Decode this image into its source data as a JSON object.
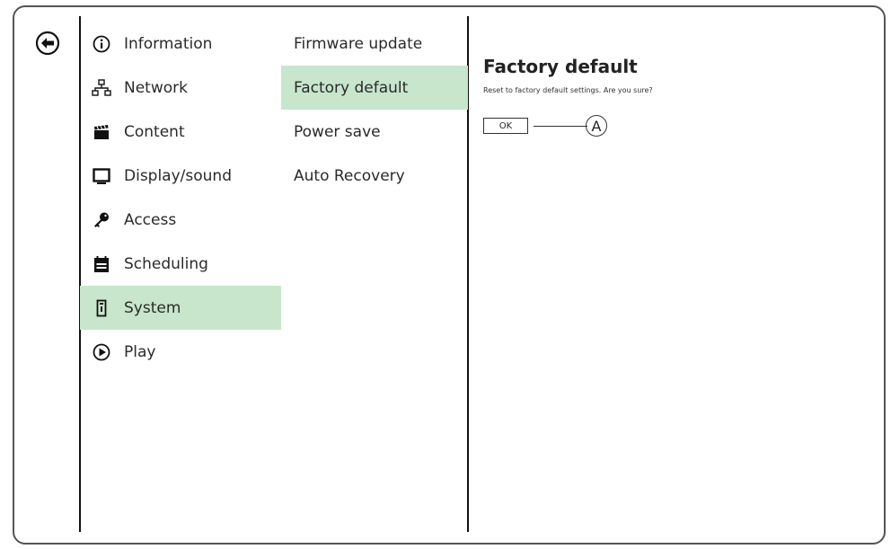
{
  "main_nav": [
    {
      "label": "Information",
      "icon": "info-icon"
    },
    {
      "label": "Network",
      "icon": "network-icon"
    },
    {
      "label": "Content",
      "icon": "clapperboard-icon"
    },
    {
      "label": "Display/sound",
      "icon": "monitor-icon"
    },
    {
      "label": "Access",
      "icon": "key-icon"
    },
    {
      "label": "Scheduling",
      "icon": "calendar-icon"
    },
    {
      "label": "System",
      "icon": "system-icon",
      "selected": true
    },
    {
      "label": "Play",
      "icon": "play-icon"
    }
  ],
  "sub_nav": [
    {
      "label": "Firmware update"
    },
    {
      "label": "Factory default",
      "selected": true
    },
    {
      "label": "Power save"
    },
    {
      "label": "Auto Recovery"
    }
  ],
  "content": {
    "title": "Factory default",
    "description": "Reset to factory default settings. Are you sure?",
    "ok_label": "OK",
    "callout_label": "A"
  },
  "colors": {
    "selected_bg": "#c8e6cc"
  }
}
